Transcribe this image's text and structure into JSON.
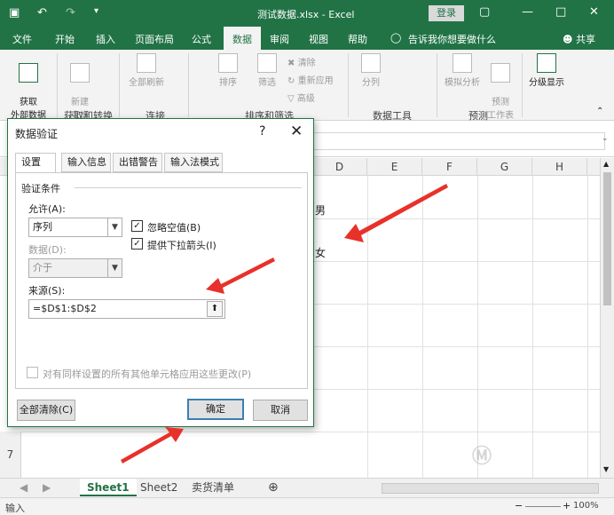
{
  "titlebar": {
    "title": "测试数据.xlsx  -  Excel",
    "login_label": "登录"
  },
  "menu": {
    "items": [
      "文件",
      "开始",
      "插入",
      "页面布局",
      "公式",
      "数据",
      "审阅",
      "视图",
      "帮助"
    ],
    "active": "数据",
    "tell_me": "告诉我你想要做什么",
    "share": "共享"
  },
  "ribbon": {
    "get_data_label": "获取\n外部数据",
    "new_query_label": "新建\n查询",
    "refresh_all_label": "全部刷新",
    "sort_label": "排序",
    "filter_label": "筛选",
    "clear_label": "清除",
    "reapply_label": "重新应用",
    "advanced_label": "高级",
    "split_label": "分列",
    "whatif_label": "模拟分析",
    "forecast_label": "预测\n工作表",
    "outline_label": "分级显示",
    "groups": {
      "get_transform": "获取和转换",
      "connections": "连接",
      "sort_filter": "排序和筛选",
      "data_tools": "数据工具",
      "forecast": "预测"
    }
  },
  "sheet": {
    "columns": [
      "D",
      "E",
      "F",
      "G",
      "H"
    ],
    "row_7": "7",
    "cells": {
      "d1": "男",
      "d2": "女"
    }
  },
  "sheet_tabs": [
    "Sheet1",
    "Sheet2",
    "卖货清单"
  ],
  "status": {
    "mode": "输入",
    "zoom": "100%"
  },
  "dialog": {
    "title": "数据验证",
    "help": "?",
    "tabs": [
      "设置",
      "输入信息",
      "出错警告",
      "输入法模式"
    ],
    "criteria_legend": "验证条件",
    "allow_label": "允许(A):",
    "allow_value": "序列",
    "ignore_blank_label": "忽略空值(B)",
    "ignore_blank_checked": true,
    "dropdown_label": "提供下拉箭头(I)",
    "dropdown_checked": true,
    "data_label": "数据(D):",
    "data_value": "介于",
    "source_label": "来源(S):",
    "source_value": "=$D$1:$D$2",
    "apply_all_label": "对有同样设置的所有其他单元格应用这些更改(P)",
    "apply_all_checked": false,
    "clear_all_label": "全部清除(C)",
    "ok_label": "确定",
    "cancel_label": "取消"
  },
  "colors": {
    "excel_green": "#217346",
    "annotation_red": "#e8312a"
  }
}
